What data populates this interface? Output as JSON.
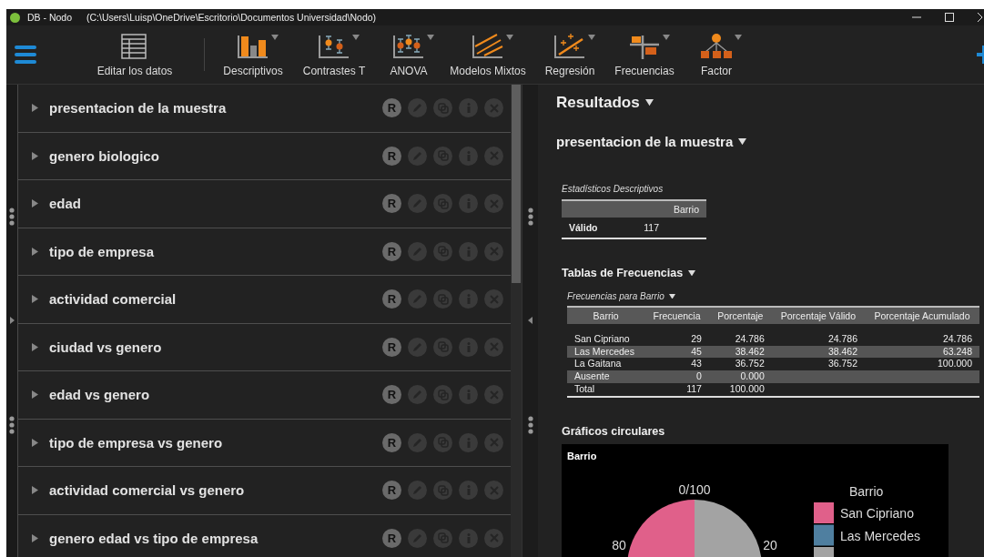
{
  "window": {
    "app_name": "DB - Nodo",
    "path": "(C:\\Users\\Luisp\\OneDrive\\Escritorio\\Documentos Universidad\\Nodo)"
  },
  "toolbar": {
    "items": [
      {
        "label": "Editar los datos",
        "kind": "table",
        "dropdown": false
      },
      {
        "label": "Descriptivos",
        "kind": "bars",
        "dropdown": true
      },
      {
        "label": "Contrastes T",
        "kind": "ttest",
        "dropdown": true
      },
      {
        "label": "ANOVA",
        "kind": "anova",
        "dropdown": true
      },
      {
        "label": "Modelos Mixtos",
        "kind": "mixed",
        "dropdown": true
      },
      {
        "label": "Regresión",
        "kind": "regression",
        "dropdown": true
      },
      {
        "label": "Frecuencias",
        "kind": "frequencies",
        "dropdown": true
      },
      {
        "label": "Factor",
        "kind": "factor",
        "dropdown": true
      }
    ]
  },
  "analyses": [
    {
      "title": "presentacion de la muestra",
      "expanded": false,
      "badge": "R"
    },
    {
      "title": "genero biologico",
      "expanded": false,
      "badge": "R"
    },
    {
      "title": "edad",
      "expanded": false,
      "badge": "R"
    },
    {
      "title": "tipo de empresa",
      "expanded": false,
      "badge": "R"
    },
    {
      "title": "actividad comercial",
      "expanded": false,
      "badge": "R"
    },
    {
      "title": "ciudad vs genero",
      "expanded": false,
      "badge": "R"
    },
    {
      "title": "edad vs genero",
      "expanded": false,
      "badge": "R"
    },
    {
      "title": "tipo de empresa vs genero",
      "expanded": false,
      "badge": "R"
    },
    {
      "title": "actividad comercial vs genero",
      "expanded": false,
      "badge": "R"
    },
    {
      "title": "genero edad vs tipo de empresa",
      "expanded": false,
      "badge": "R"
    }
  ],
  "results": {
    "heading": "Resultados",
    "section": "presentacion de la muestra",
    "descriptives": {
      "title": "Estadísticos Descriptivos",
      "columns": [
        "",
        "Barrio"
      ],
      "rows": [
        [
          "Válido",
          "117"
        ]
      ]
    },
    "frequencies": {
      "title": "Tablas de Frecuencias",
      "subtitle": "Frecuencias para Barrio",
      "columns": [
        "Barrio",
        "Frecuencia",
        "Porcentaje",
        "Porcentaje Válido",
        "Porcentaje Acumulado"
      ],
      "rows": [
        {
          "cells": [
            "San Cipriano",
            "29",
            "24.786",
            "24.786",
            "24.786"
          ],
          "shaded": false
        },
        {
          "cells": [
            "Las Mercedes",
            "45",
            "38.462",
            "38.462",
            "63.248"
          ],
          "shaded": true
        },
        {
          "cells": [
            "La Gaitana",
            "43",
            "36.752",
            "36.752",
            "100.000"
          ],
          "shaded": false
        },
        {
          "cells": [
            "Ausente",
            "0",
            "0.000"
          ],
          "shaded": true
        },
        {
          "cells": [
            "Total",
            "117",
            "100.000"
          ],
          "shaded": false
        }
      ]
    },
    "charts": {
      "title": "Gráficos circulares",
      "chart_title": "Barrio",
      "pie_labels": [
        "0/100",
        "20",
        "80"
      ],
      "legend": {
        "title": "Barrio",
        "items": [
          {
            "label": "San Cipriano",
            "color": "#e0608a"
          },
          {
            "label": "Las Mercedes",
            "color": "#4f7fa0"
          },
          {
            "color": "#a3a3a3"
          }
        ]
      }
    }
  }
}
